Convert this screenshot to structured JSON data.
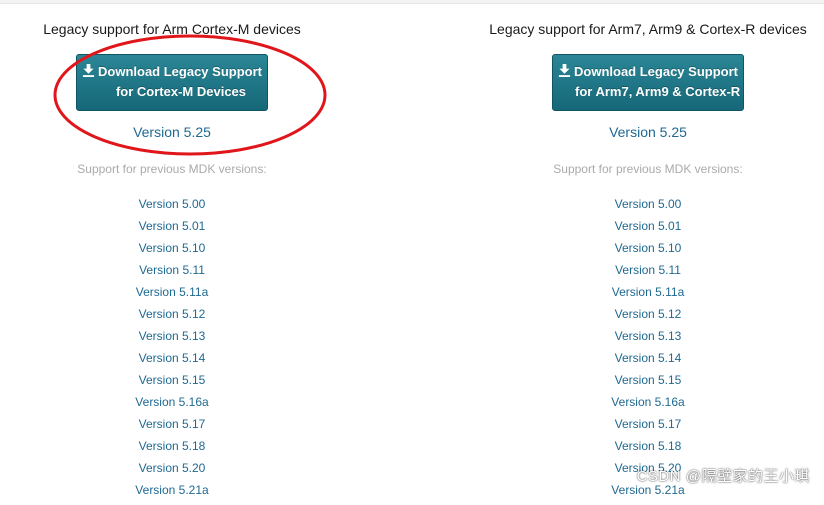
{
  "columns": [
    {
      "heading": "Legacy support for Arm Cortex-M devices",
      "button_line1": "Download Legacy Support",
      "button_line2": "for Cortex-M Devices",
      "current_version": "Version 5.25",
      "support_note": "Support for previous MDK versions:",
      "versions": [
        "Version 5.00",
        "Version 5.01",
        "Version 5.10",
        "Version 5.11",
        "Version 5.11a",
        "Version 5.12",
        "Version 5.13",
        "Version 5.14",
        "Version 5.15",
        "Version 5.16a",
        "Version 5.17",
        "Version 5.18",
        "Version 5.20",
        "Version 5.21a"
      ]
    },
    {
      "heading": "Legacy support for Arm7, Arm9 & Cortex-R devices",
      "button_line1": "Download Legacy Support",
      "button_line2": "for Arm7, Arm9 & Cortex-R",
      "current_version": "Version 5.25",
      "support_note": "Support for previous MDK versions:",
      "versions": [
        "Version 5.00",
        "Version 5.01",
        "Version 5.10",
        "Version 5.11",
        "Version 5.11a",
        "Version 5.12",
        "Version 5.13",
        "Version 5.14",
        "Version 5.15",
        "Version 5.16a",
        "Version 5.17",
        "Version 5.18",
        "Version 5.20",
        "Version 5.21a"
      ]
    }
  ],
  "icons": {
    "download": "download-icon"
  },
  "annotation": {
    "shape": "ellipse",
    "color": "#e0161b"
  },
  "colors": {
    "button": "#1e7585",
    "link": "#1f6991",
    "note": "#aaaaaa"
  },
  "watermark": "CSDN @隔壁家的王小琪"
}
